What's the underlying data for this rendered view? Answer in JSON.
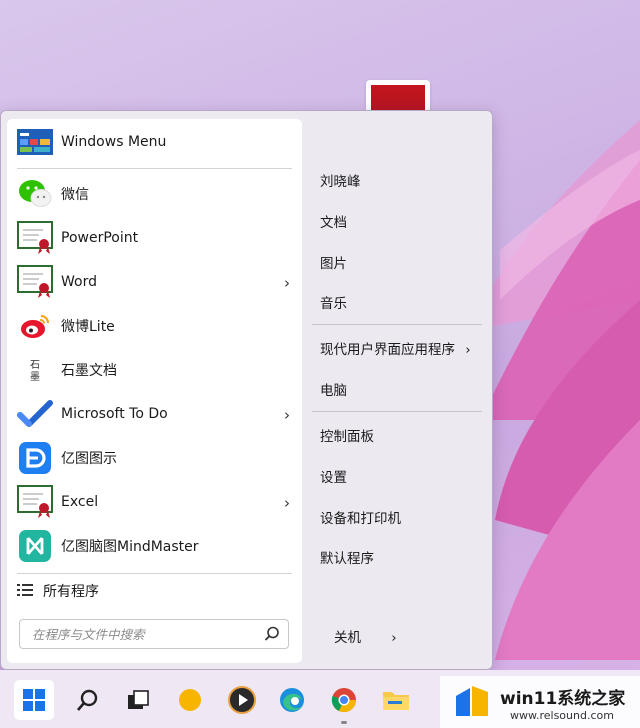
{
  "apps": [
    {
      "label": "Windows Menu",
      "icon": "windows-menu-icon",
      "arrow": false
    },
    {
      "label": "微信",
      "icon": "wechat-icon",
      "arrow": false
    },
    {
      "label": "PowerPoint",
      "icon": "certificate-icon",
      "arrow": false
    },
    {
      "label": "Word",
      "icon": "certificate-icon",
      "arrow": true
    },
    {
      "label": "微博Lite",
      "icon": "weibo-icon",
      "arrow": false
    },
    {
      "label": "石墨文档",
      "icon": "shimo-icon",
      "arrow": false
    },
    {
      "label": "Microsoft To Do",
      "icon": "todo-check-icon",
      "arrow": true
    },
    {
      "label": "亿图图示",
      "icon": "edraw-icon",
      "arrow": false
    },
    {
      "label": "Excel",
      "icon": "certificate-icon",
      "arrow": true
    },
    {
      "label": "亿图脑图MindMaster",
      "icon": "mindmaster-icon",
      "arrow": false
    }
  ],
  "all_programs": "所有程序",
  "search": {
    "placeholder": "在程序与文件中搜索"
  },
  "right": {
    "user": "刘晓峰",
    "documents": "文档",
    "pictures": "图片",
    "music": "音乐",
    "modern_apps": "现代用户界面应用程序",
    "computer": "电脑",
    "control_panel": "控制面板",
    "settings": "设置",
    "devices": "设备和打印机",
    "defaults": "默认程序",
    "shutdown": "关机"
  },
  "shimo_icon_text": "石\n墨",
  "watermark": {
    "title": "win11系统之家",
    "url": "www.relsound.com"
  },
  "colors": {
    "accent": "#0a64d2",
    "wechat": "#2dc100",
    "weibo": "#e6162d",
    "todo": "#2564cf"
  }
}
